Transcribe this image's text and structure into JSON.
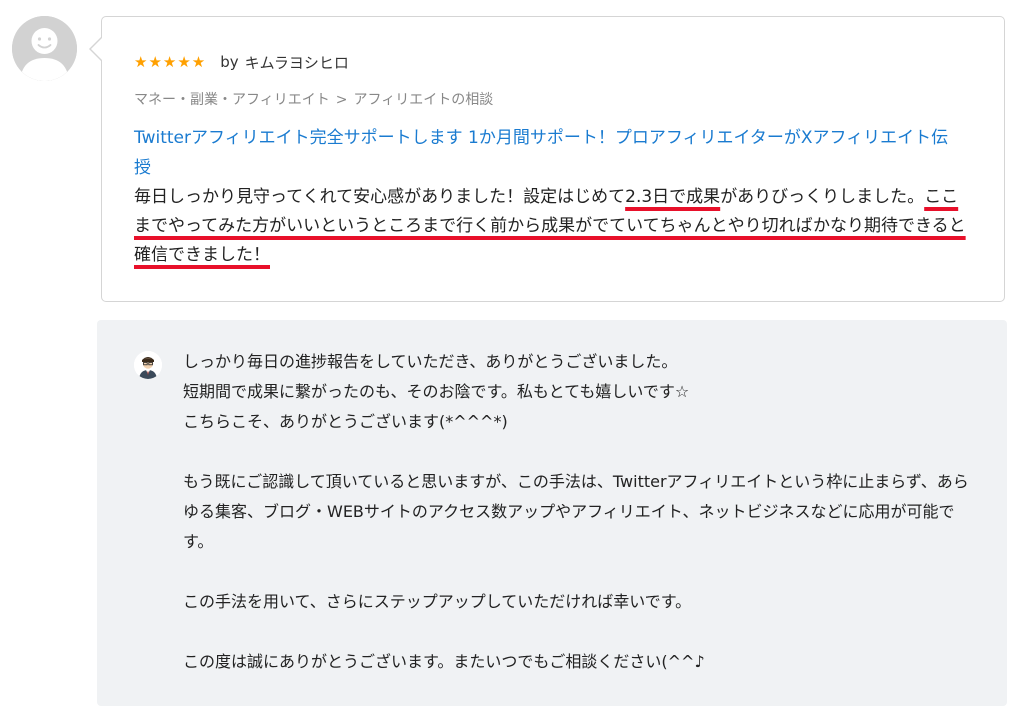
{
  "review": {
    "stars": "★★★★★",
    "by_label": "by",
    "reviewer_name": "キムラヨシヒロ",
    "breadcrumb": [
      "マネー・副業・アフィリエイト",
      "アフィリエイトの相談"
    ],
    "breadcrumb_separator": ">",
    "service_title": "Twitterアフィリエイト完全サポートします 1か月間サポート！プロアフィリエイターがXアフィリエイト伝授",
    "body": {
      "part1": "毎日しっかり見守ってくれて安心感がありました！設定はじめて",
      "part2": "2.3日で成果",
      "part3": "がありびっくりしました。",
      "part4": "ここまでやってみた方がいいというところまで行く前から成果がでていてちゃんとやり切ればかなり期待できると確信できました！"
    }
  },
  "reply": {
    "lines": [
      "しっかり毎日の進捗報告をしていただき、ありがとうございました。",
      "短期間で成果に繋がったのも、そのお陰です。私もとても嬉しいです☆",
      "こちらこそ、ありがとうございます(*^^^*)",
      "もう既にご認識して頂いていると思いますが、この手法は、Twitterアフィリエイトという枠に止まらず、あらゆる集客、ブログ・WEBサイトのアクセス数アップやアフィリエイト、ネットビジネスなどに応用が可能です。",
      "この手法を用いて、さらにステップアップしていただければ幸いです。",
      "この度は誠にありがとうございます。またいつでもご相談ください(^^♪"
    ]
  },
  "colors": {
    "star": "#ffa000",
    "link": "#1a7bd0",
    "underline": "#e8102a",
    "reply_bg": "#f0f2f4"
  },
  "icons": {
    "reviewer_avatar": "default-user-avatar-icon",
    "seller_avatar": "seller-avatar-icon"
  }
}
